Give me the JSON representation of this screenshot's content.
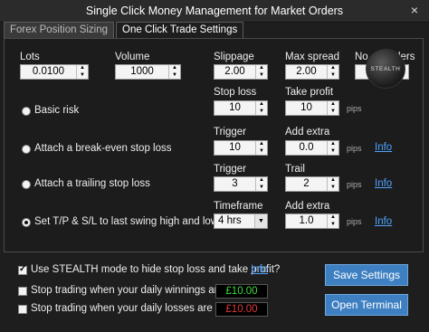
{
  "window": {
    "title": "Single Click Money Management for Market Orders",
    "close": "×"
  },
  "tabs": [
    {
      "label": "Forex Position Sizing"
    },
    {
      "label": "One Click Trade Settings"
    }
  ],
  "fields": {
    "lots": {
      "label": "Lots",
      "value": "0.0100"
    },
    "volume": {
      "label": "Volume",
      "value": "1000"
    },
    "slippage": {
      "label": "Slippage",
      "value": "2.00"
    },
    "max_spread": {
      "label": "Max spread",
      "value": "2.00"
    },
    "no_orders": {
      "label": "No. of orders",
      "value": "2"
    },
    "stop_loss": {
      "label": "Stop loss",
      "value": "10"
    },
    "take_profit": {
      "label": "Take profit",
      "value": "10"
    },
    "be_trigger": {
      "label": "Trigger",
      "value": "10"
    },
    "be_add_extra": {
      "label": "Add extra",
      "value": "0.0"
    },
    "trail_trigger": {
      "label": "Trigger",
      "value": "3"
    },
    "trail": {
      "label": "Trail",
      "value": "2"
    },
    "timeframe": {
      "label": "Timeframe",
      "value": "4 hrs"
    },
    "swing_add_extra": {
      "label": "Add extra",
      "value": "1.0"
    }
  },
  "radios": {
    "basic_risk": "Basic risk",
    "break_even": "Attach a break-even stop loss",
    "trailing": "Attach a trailing stop loss",
    "swing": "Set T/P & S/L to last swing high and low"
  },
  "pips": "pips",
  "info": "Info",
  "stealth_logo": "STEALTH",
  "bottom": {
    "stealth_mode": "Use STEALTH mode to hide stop loss and take profit?",
    "stop_winnings": "Stop trading when your daily winnings are",
    "stop_losses": "Stop trading when your daily losses are",
    "winnings_value": "£10.00",
    "losses_value": "£10.00",
    "save_button": "Save Settings",
    "open_terminal": "Open Terminal"
  },
  "colors": {
    "accent": "#3d7fc1",
    "win": "#3ddc3d",
    "loss": "#e03a3a",
    "link": "#4ea3ff"
  }
}
